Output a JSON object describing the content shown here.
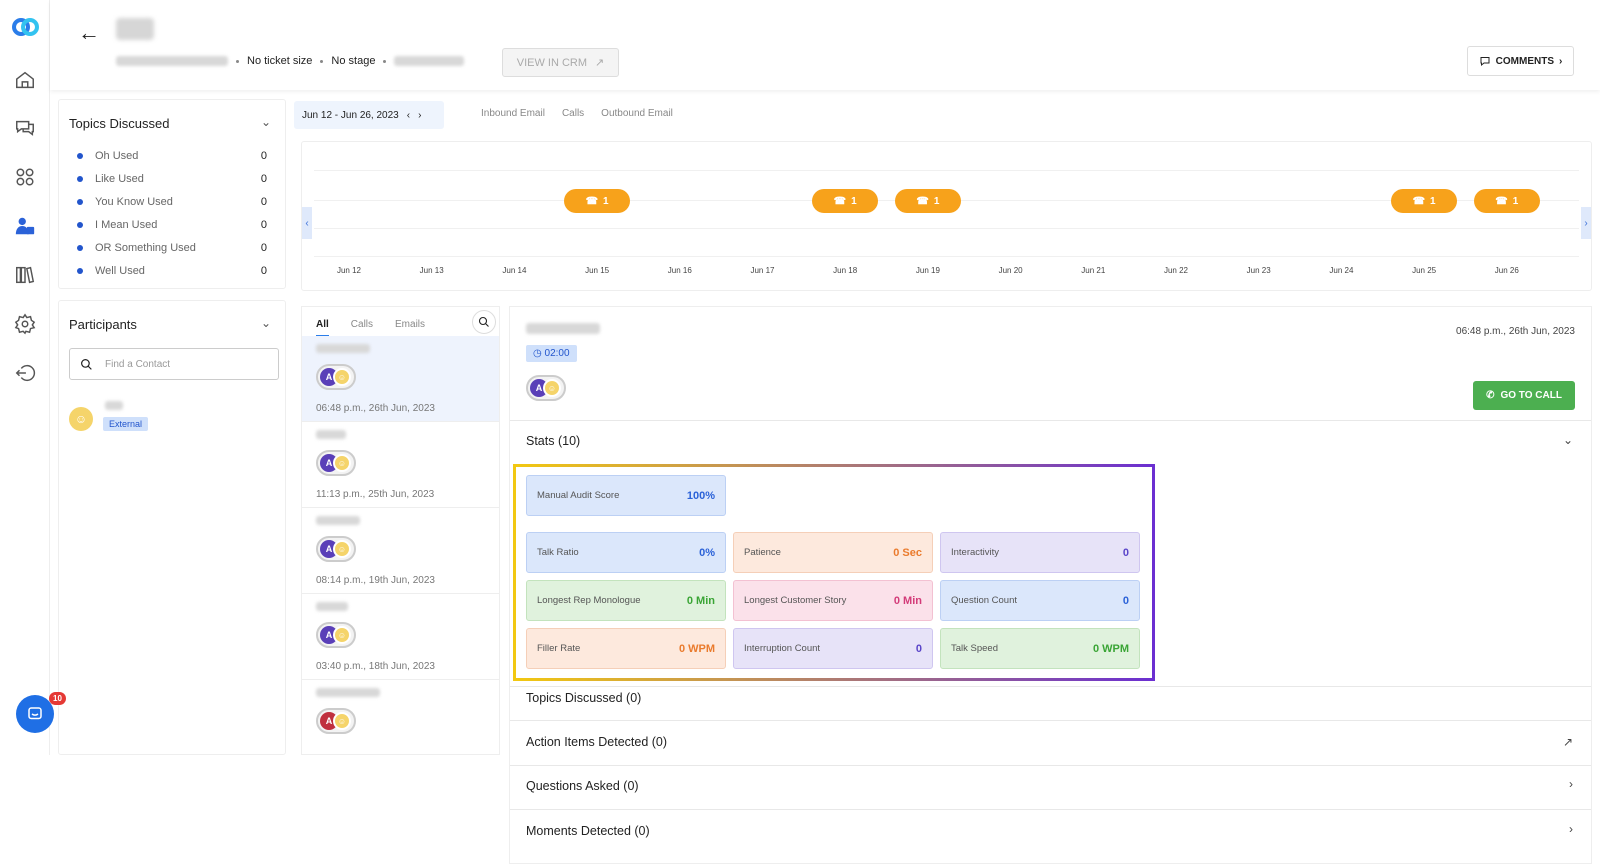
{
  "header": {
    "meta": {
      "ticket": "No ticket size",
      "stage": "No stage"
    },
    "crm_button": "VIEW IN CRM",
    "comments_button": "COMMENTS"
  },
  "topics": {
    "title": "Topics Discussed",
    "items": [
      {
        "label": "Oh Used",
        "count": "0"
      },
      {
        "label": "Like Used",
        "count": "0"
      },
      {
        "label": "You Know Used",
        "count": "0"
      },
      {
        "label": "I Mean Used",
        "count": "0"
      },
      {
        "label": "OR Something Used",
        "count": "0"
      },
      {
        "label": "Well Used",
        "count": "0"
      }
    ]
  },
  "participants": {
    "title": "Participants",
    "search_placeholder": "Find a Contact",
    "badge": "External"
  },
  "timeline": {
    "date_range": "Jun 12 - Jun 26, 2023",
    "channels": [
      "Inbound Email",
      "Calls",
      "Outbound Email"
    ],
    "dates": [
      "Jun 12",
      "Jun 13",
      "Jun 14",
      "Jun 15",
      "Jun 16",
      "Jun 17",
      "Jun 18",
      "Jun 19",
      "Jun 20",
      "Jun 21",
      "Jun 22",
      "Jun 23",
      "Jun 24",
      "Jun 25",
      "Jun 26"
    ],
    "calls": [
      {
        "date": "Jun 15",
        "count": "1"
      },
      {
        "date": "Jun 18",
        "count": "1"
      },
      {
        "date": "Jun 19",
        "count": "1"
      },
      {
        "date": "Jun 25",
        "count": "1"
      },
      {
        "date": "Jun 26",
        "count": "1"
      }
    ]
  },
  "conversations": {
    "tabs": [
      "All",
      "Calls",
      "Emails"
    ],
    "items": [
      {
        "time": "06:48 p.m., 26th Jun, 2023",
        "avatar_letter": "A"
      },
      {
        "time": "11:13 p.m., 25th Jun, 2023",
        "avatar_letter": "A"
      },
      {
        "time": "08:14 p.m., 19th Jun, 2023",
        "avatar_letter": "A"
      },
      {
        "time": "03:40 p.m., 18th Jun, 2023",
        "avatar_letter": "A"
      },
      {
        "time": "",
        "avatar_letter": "A"
      }
    ]
  },
  "detail": {
    "duration": "02:00",
    "timestamp": "06:48 p.m., 26th Jun, 2023",
    "avatar_letter": "A",
    "go_to_call": "GO TO CALL",
    "stats_title": "Stats (10)",
    "stats": {
      "manual_audit": {
        "label": "Manual Audit Score",
        "value": "100%"
      },
      "talk_ratio": {
        "label": "Talk Ratio",
        "value": "0%"
      },
      "patience": {
        "label": "Patience",
        "value": "0 Sec"
      },
      "interactivity": {
        "label": "Interactivity",
        "value": "0"
      },
      "longest_rep": {
        "label": "Longest Rep Monologue",
        "value": "0 Min"
      },
      "longest_customer": {
        "label": "Longest Customer Story",
        "value": "0 Min"
      },
      "question_count": {
        "label": "Question Count",
        "value": "0"
      },
      "filler_rate": {
        "label": "Filler Rate",
        "value": "0 WPM"
      },
      "interruption_count": {
        "label": "Interruption Count",
        "value": "0"
      },
      "talk_speed": {
        "label": "Talk Speed",
        "value": "0 WPM"
      }
    },
    "sections": {
      "topics": "Topics Discussed (0)",
      "action_items": "Action Items Detected (0)",
      "questions": "Questions Asked (0)",
      "moments": "Moments Detected (0)"
    }
  },
  "chat": {
    "badge": "10"
  },
  "colors": {
    "accent": "#2b7de9",
    "call_pill": "#f7a21b",
    "go_to_call": "#4caf50"
  }
}
